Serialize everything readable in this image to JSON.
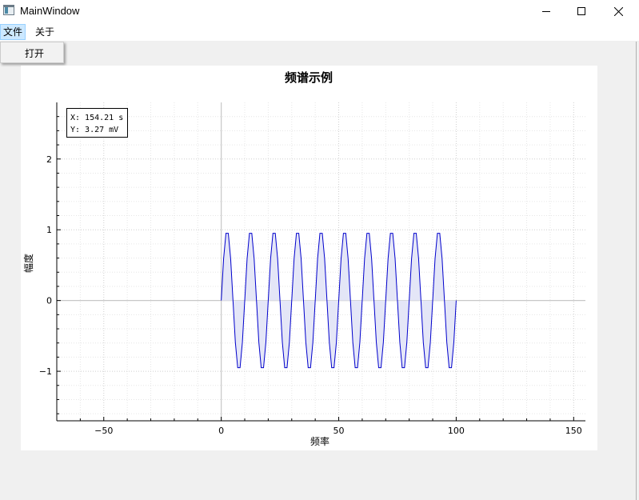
{
  "window": {
    "title": "MainWindow"
  },
  "menubar": {
    "items": [
      {
        "label": "文件",
        "active": true
      },
      {
        "label": "关于",
        "active": false
      }
    ],
    "file_menu": {
      "open_label": "打开"
    }
  },
  "chart_data": {
    "type": "line",
    "title": "频谱示例",
    "xlabel": "频率",
    "ylabel": "幅度",
    "xlim": [
      -70,
      155
    ],
    "ylim": [
      -1.7,
      2.8
    ],
    "x_ticks": [
      -50,
      0,
      50,
      100,
      150
    ],
    "x_tick_labels": [
      "−50",
      "0",
      "50",
      "100",
      "150"
    ],
    "y_ticks": [
      -1,
      0,
      1,
      2
    ],
    "y_tick_labels": [
      "−1",
      "0",
      "1",
      "2"
    ],
    "grid": true,
    "fill_to_zero": true,
    "series": [
      {
        "color": "#0000cc",
        "fill": "#e4e6f7",
        "x": [
          0,
          1,
          2,
          3,
          4,
          5,
          6,
          7,
          8,
          9,
          10,
          11,
          12,
          13,
          14,
          15,
          16,
          17,
          18,
          19,
          20,
          21,
          22,
          23,
          24,
          25,
          26,
          27,
          28,
          29,
          30,
          31,
          32,
          33,
          34,
          35,
          36,
          37,
          38,
          39,
          40,
          41,
          42,
          43,
          44,
          45,
          46,
          47,
          48,
          49,
          50,
          51,
          52,
          53,
          54,
          55,
          56,
          57,
          58,
          59,
          60,
          61,
          62,
          63,
          64,
          65,
          66,
          67,
          68,
          69,
          70,
          71,
          72,
          73,
          74,
          75,
          76,
          77,
          78,
          79,
          80,
          81,
          82,
          83,
          84,
          85,
          86,
          87,
          88,
          89,
          90,
          91,
          92,
          93,
          94,
          95,
          96,
          97,
          98,
          99
        ],
        "y": [
          0,
          0.59,
          0.95,
          0.95,
          0.59,
          0,
          -0.59,
          -0.95,
          -0.95,
          -0.59,
          0,
          0.59,
          0.95,
          0.95,
          0.59,
          0,
          -0.59,
          -0.95,
          -0.95,
          -0.59,
          0,
          0.59,
          0.95,
          0.95,
          0.59,
          0,
          -0.59,
          -0.95,
          -0.95,
          -0.59,
          0,
          0.59,
          0.95,
          0.95,
          0.59,
          0,
          -0.59,
          -0.95,
          -0.95,
          -0.59,
          0,
          0.59,
          0.95,
          0.95,
          0.59,
          0,
          -0.59,
          -0.95,
          -0.95,
          -0.59,
          0,
          0.59,
          0.95,
          0.95,
          0.59,
          0,
          -0.59,
          -0.95,
          -0.95,
          -0.59,
          0,
          0.59,
          0.95,
          0.95,
          0.59,
          0,
          -0.59,
          -0.95,
          -0.95,
          -0.59,
          0,
          0.59,
          0.95,
          0.95,
          0.59,
          0,
          -0.59,
          -0.95,
          -0.95,
          -0.59,
          0,
          0.59,
          0.95,
          0.95,
          0.59,
          0,
          -0.59,
          -0.95,
          -0.95,
          -0.59,
          0,
          0.59,
          0.95,
          0.95,
          0.59,
          0,
          -0.59,
          -0.95,
          -0.95,
          -0.59
        ]
      }
    ],
    "cursor_readout": {
      "x_text": "X: 154.21 s",
      "y_text": "Y: 3.27 mV"
    }
  }
}
